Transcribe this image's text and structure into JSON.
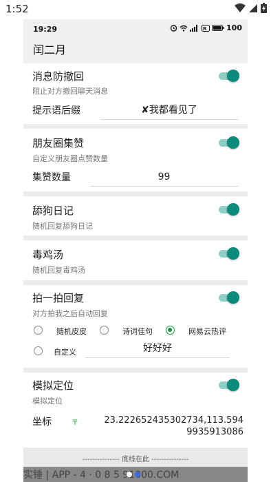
{
  "outer_status": {
    "time": "1:52"
  },
  "inner_status": {
    "time": "19:29",
    "battery": "100"
  },
  "app": {
    "title": "闰二月"
  },
  "sections": {
    "recall": {
      "title": "消息防撤回",
      "subtitle": "阻止对方撤回聊天消息",
      "enabled": true,
      "suffix_label": "提示语后缀",
      "suffix_value": "✘我都看见了"
    },
    "moments": {
      "title": "朋友圈集赞",
      "subtitle": "自定义朋友圈点赞数量",
      "enabled": true,
      "count_label": "集赞数量",
      "count_value": "99"
    },
    "diary": {
      "title": "舔狗日记",
      "subtitle": "随机回复舔狗日记",
      "enabled": true
    },
    "soup": {
      "title": "毒鸡汤",
      "subtitle": "随机回复毒鸡汤",
      "enabled": true
    },
    "pat": {
      "title": "拍一拍回复",
      "subtitle": "对方拍我之后自动回复",
      "enabled": true,
      "options": [
        {
          "label": "随机皮皮",
          "checked": false
        },
        {
          "label": "诗词佳句",
          "checked": false
        },
        {
          "label": "网易云热评",
          "checked": true
        },
        {
          "label": "自定义",
          "checked": false
        }
      ],
      "custom_value": "好好好"
    },
    "location": {
      "title": "模拟定位",
      "subtitle": "模拟定位",
      "enabled": true,
      "coord_label": "坐标",
      "coord_value": "23.222652435302734,113.5949935913086"
    }
  },
  "footer": {
    "text": "--------------- 底线在此 ---------------",
    "overlay_text": "实锤 | APP - 4 · 0 8 5 91000.COM"
  },
  "colors": {
    "accent": "#0c8b7d",
    "radio_checked": "#1a9a3a",
    "divider": "#ececec"
  }
}
